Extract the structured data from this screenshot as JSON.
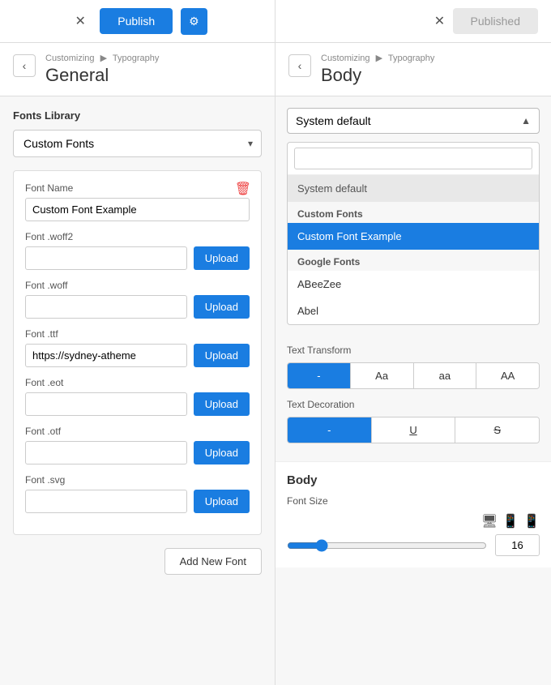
{
  "topbar": {
    "close_left": "✕",
    "publish_label": "Publish",
    "settings_icon": "⚙",
    "close_right": "✕",
    "published_label": "Published"
  },
  "left_panel": {
    "breadcrumb_part1": "Customizing",
    "breadcrumb_sep": "▶",
    "breadcrumb_part2": "Typography",
    "title": "General",
    "back_icon": "‹",
    "fonts_library_label": "Fonts Library",
    "fonts_dropdown_value": "Custom Fonts",
    "fonts_dropdown_arrow": "▾",
    "font_card": {
      "delete_icon": "🗑",
      "font_name_label": "Font Name",
      "font_name_value": "Custom Font Example",
      "font_woff2_label": "Font .woff2",
      "font_woff2_value": "",
      "font_woff_label": "Font .woff",
      "font_woff_value": "",
      "font_ttf_label": "Font .ttf",
      "font_ttf_value": "https://sydney-atheme",
      "font_eot_label": "Font .eot",
      "font_eot_value": "",
      "font_otf_label": "Font .otf",
      "font_otf_value": "",
      "font_svg_label": "Font .svg",
      "font_svg_value": "",
      "upload_label": "Upload"
    },
    "add_new_font_label": "Add New Font"
  },
  "right_panel": {
    "breadcrumb_part1": "Customizing",
    "breadcrumb_sep": "▶",
    "breadcrumb_part2": "Typography",
    "title": "Body",
    "back_icon": "‹",
    "dropdown_value": "System default",
    "dropdown_arrow": "▲",
    "search_placeholder": "",
    "menu_items": [
      {
        "type": "item",
        "label": "System default",
        "style": "system-default"
      },
      {
        "type": "group",
        "label": "Custom Fonts"
      },
      {
        "type": "item",
        "label": "Custom Font Example",
        "style": "selected"
      },
      {
        "type": "group",
        "label": "Google Fonts"
      },
      {
        "type": "item",
        "label": "ABeeZee",
        "style": ""
      },
      {
        "type": "item",
        "label": "Abel",
        "style": ""
      }
    ],
    "text_transform_label": "Text Transform",
    "transform_buttons": [
      {
        "label": "-",
        "active": true
      },
      {
        "label": "Aa",
        "active": false
      },
      {
        "label": "aa",
        "active": false
      },
      {
        "label": "AA",
        "active": false
      }
    ],
    "text_decoration_label": "Text Decoration",
    "decoration_buttons": [
      {
        "label": "-",
        "active": true
      },
      {
        "label": "U̲",
        "active": false
      },
      {
        "label": "S̶",
        "active": false
      }
    ],
    "body_section_title": "Body",
    "font_size_label": "Font Size",
    "slider_value": 16,
    "slider_min": 1,
    "slider_max": 100,
    "size_value": "16"
  }
}
